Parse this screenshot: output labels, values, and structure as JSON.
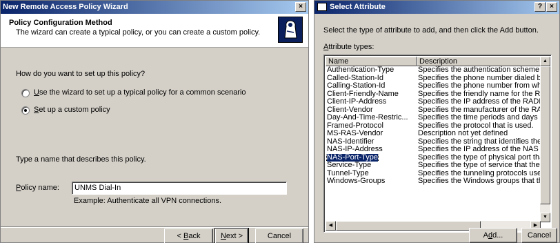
{
  "wizard": {
    "title": "New Remote Access Policy Wizard",
    "close_label": "×",
    "header_title": "Policy Configuration Method",
    "header_subtitle": "The wizard can create a typical policy, or you can create a custom policy.",
    "question": "How do you want to set up this policy?",
    "options": [
      {
        "accel": "U",
        "rest": "se the wizard to set up a typical policy for a common scenario",
        "checked": false
      },
      {
        "accel": "S",
        "rest": "et up a custom policy",
        "checked": true
      }
    ],
    "name_prompt": "Type a name that describes this policy.",
    "policy_name_accel": "P",
    "policy_name_rest": "olicy name:",
    "policy_name_value": "UNMS Dial-In",
    "example": "Example: Authenticate all VPN connections.",
    "buttons": {
      "back_prefix": "< ",
      "back_accel": "B",
      "back_rest": "ack",
      "next_accel": "N",
      "next_rest": "ext >",
      "cancel": "Cancel"
    }
  },
  "select_attribute": {
    "title": "Select Attribute",
    "help_label": "?",
    "close_label": "×",
    "instruction": "Select the type of attribute to add, and then click the Add button.",
    "types_accel": "A",
    "types_rest": "ttribute types:",
    "columns": [
      "Name",
      "Description"
    ],
    "rows": [
      {
        "name": "Authentication-Type",
        "description": "Specifies the authentication scheme that is u",
        "selected": false
      },
      {
        "name": "Called-Station-Id",
        "description": "Specifies the phone number dialed by the us",
        "selected": false
      },
      {
        "name": "Calling-Station-Id",
        "description": "Specifies the phone number from which the c",
        "selected": false
      },
      {
        "name": "Client-Friendly-Name",
        "description": "Specifies the friendly name for the RADIUS c",
        "selected": false
      },
      {
        "name": "Client-IP-Address",
        "description": "Specifies the IP address of the RADIUS clier",
        "selected": false
      },
      {
        "name": "Client-Vendor",
        "description": "Specifies the manufacturer of the RADIUS p",
        "selected": false
      },
      {
        "name": "Day-And-Time-Restric...",
        "description": "Specifies the time periods and days of week",
        "selected": false
      },
      {
        "name": "Framed-Protocol",
        "description": "Specifies the protocol that is used.",
        "selected": false
      },
      {
        "name": "MS-RAS-Vendor",
        "description": "Description not yet defined",
        "selected": false
      },
      {
        "name": "NAS-Identifier",
        "description": "Specifies the string that identifies the NAS th",
        "selected": false
      },
      {
        "name": "NAS-IP-Address",
        "description": "Specifies the IP address of the NAS where th",
        "selected": false
      },
      {
        "name": "NAS-Port-Type",
        "description": "Specifies the type of physical port that is use",
        "selected": true
      },
      {
        "name": "Service-Type",
        "description": "Specifies the type of service that the user ha",
        "selected": false
      },
      {
        "name": "Tunnel-Type",
        "description": "Specifies the tunneling protocols used.",
        "selected": false
      },
      {
        "name": "Windows-Groups",
        "description": "Specifies the Windows groups that the user b",
        "selected": false
      }
    ],
    "add_prefix": "A",
    "add_accel": "d",
    "add_rest": "d...",
    "cancel": "Cancel"
  }
}
